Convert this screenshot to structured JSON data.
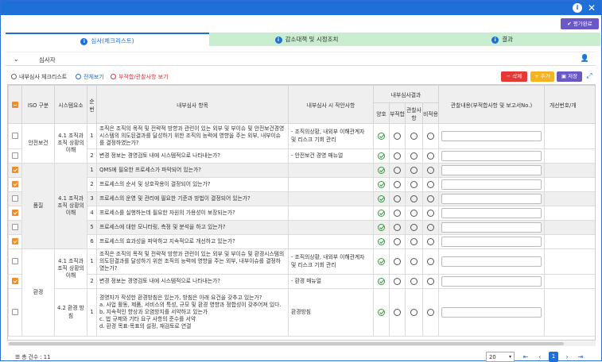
{
  "window": {
    "info_icon": "info-icon",
    "close_icon": "close-icon"
  },
  "actions": {
    "complete_label": "평가완료",
    "complete_icon": "check-icon"
  },
  "tabs": [
    {
      "label": "심사(체크리스트)",
      "icon": "info-icon"
    },
    {
      "label": "감소대책 및 시정조치",
      "icon": "info-icon"
    },
    {
      "label": "결과",
      "icon": "info-icon"
    }
  ],
  "section": {
    "title": "심사자",
    "collapse_icon": "chevron-down-icon",
    "user_icon": "user-icon"
  },
  "toolbar": {
    "checklist_label": "내부심사 체크리스트",
    "view_all_label": "전체보기",
    "view_nonconf_label": "부적합/관찰사항 보기",
    "delete_label": "삭제",
    "add_label": "추가",
    "save_label": "저장",
    "expand_icon": "expand-icon"
  },
  "grid": {
    "headers": {
      "iso": "ISO 구분",
      "system": "시스템요소",
      "seq": "순번",
      "item": "내부심사 항목",
      "notes": "내부심사 시 작안사항",
      "result_group": "내부심사결과",
      "good": "양호",
      "nonconf": "부적합",
      "observe": "관찰사항",
      "na": "비적용",
      "remarks": "관찰내용(부적합사항 및 보고서No.)",
      "improve": "개선번호/개"
    },
    "groups": [
      {
        "iso": "안전보건",
        "rows": [
          {
            "system": "4.1 조직과 조직 상황의 이해",
            "seq": "1",
            "checked": false,
            "item": "조직은 조직의 목적 및 전략적 방향과 관련이 있는 외부 및 부이슈 및 안전보건경영시스템의 의도된결과를 달성하기 위한 조직의 능력에 영향을 주는 외부, 내부이슈를 결정하였는가?",
            "notes": "- 조직의상황, 내외부 이해관계자 및 리스크 기회 관리",
            "result": "ok"
          },
          {
            "system": "",
            "seq": "2",
            "checked": false,
            "item": "변경 정보는 경영검토 내에 시스템적으로 나타내는가?",
            "notes": "- 안전보건 경영 매뉴얼",
            "result": "ok"
          }
        ]
      },
      {
        "iso": "품질",
        "rows": [
          {
            "system": "4.1 조직과 조직 상황의 이해",
            "seq": "1",
            "checked": true,
            "item": "QMS에 필요한 프로세스가 파악되어 있는가?",
            "notes": "",
            "result": "ok"
          },
          {
            "system": "",
            "seq": "2",
            "checked": true,
            "item": "프로세스의 순서 및 상호작용이 결정되어 있는가?",
            "notes": "",
            "result": "ok"
          },
          {
            "system": "",
            "seq": "3",
            "checked": false,
            "item": "프로세스의 운영 및 관리에 필요한 기준과 방법이 결정되어 있는가?",
            "notes": "",
            "result": "ok"
          },
          {
            "system": "",
            "seq": "4",
            "checked": true,
            "item": "프로세스를 실행하는데 필요한 자원의 가용성이 보장되는가?",
            "notes": "",
            "result": "ok"
          },
          {
            "system": "",
            "seq": "5",
            "checked": false,
            "item": "프로세스에 대한 모니터링, 측정 및 분석을 하고 있는가?",
            "notes": "",
            "result": "ok"
          },
          {
            "system": "",
            "seq": "6",
            "checked": true,
            "item": "프로세스의 효과성을 파악하고 지속적으로 개선하고 있는가?",
            "notes": "",
            "result": "ok"
          }
        ]
      },
      {
        "iso": "환경",
        "rows": [
          {
            "system": "4.1 조직과 조직 상황의 이해",
            "seq": "1",
            "checked": false,
            "item": "조직은 조직의 목적 및 전략적 방향과 관련이 있는 외부 및 부이슈 및 환경시스템의 의도된결과를 달성하기 위한 조직의 능력에 영향을 주는 외부, 내부이슈를 결정하였는가?",
            "notes": "- 조직의상황, 내외부 이해관계자 및 리스크 기회 관리",
            "result": "ok"
          },
          {
            "system": "",
            "seq": "2",
            "checked": true,
            "item": "변경 정보는 경영검토 내에 시스템적으로 나타내는가?",
            "notes": "- 환경 매뉴얼",
            "result": "ok"
          },
          {
            "system": "4.2 환경 방침",
            "seq": "1",
            "checked": false,
            "item": "경영자가 작성한 환경방침은 있는가, 방침은 아래 요건을 갖추고 있는가?\na. 사업 활동, 제품, 서비스의 특성, 규모 및 환경 영향과 정합성이 갖추어져 있다.\nb. 지속적인 향상과 오염방지를 서약하고 있는가\nc. 법 규제와 기타 요구 사항의 준수를 서약\nd. 환경 목표·목표의 설정, 재검토로 연결",
            "notes": "환경방침",
            "result": "ok"
          }
        ]
      }
    ]
  },
  "footer": {
    "count_label": "총 건수 : 11",
    "page_size": "20",
    "current_page": "1",
    "first_icon": "first-page-icon",
    "prev_icon": "prev-page-icon",
    "next_icon": "next-page-icon",
    "last_icon": "last-page-icon"
  },
  "colors": {
    "brand": "#1f6fd8",
    "tab_inactive": "#c8edcf",
    "delete": "#e53935",
    "add": "#f5b320",
    "save": "#6b57c8",
    "check": "#f28c28",
    "ok": "#2e9e3a"
  }
}
